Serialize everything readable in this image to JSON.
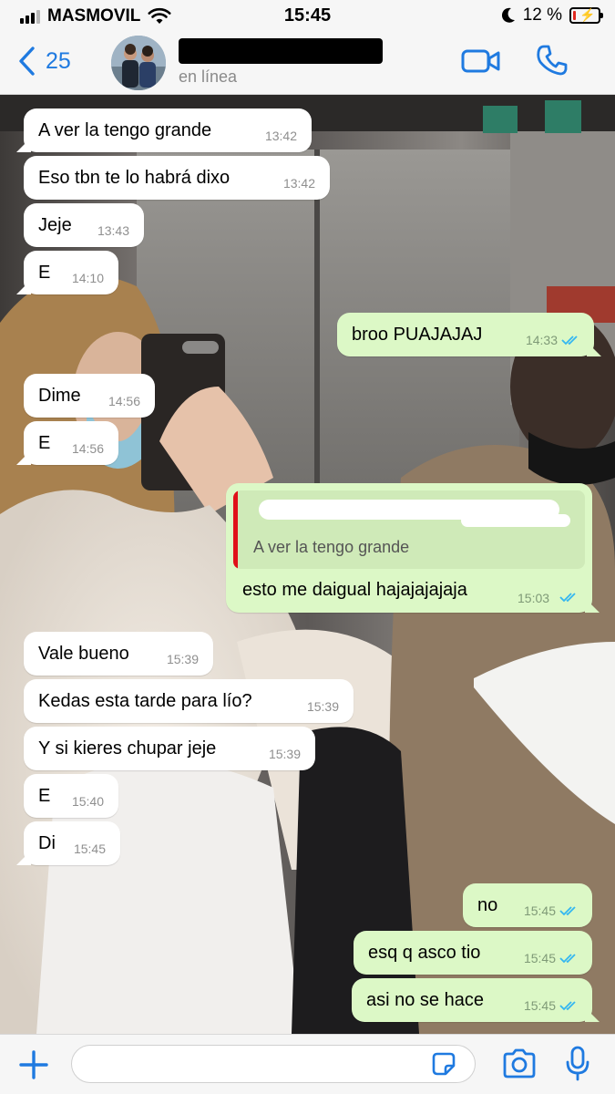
{
  "status_bar": {
    "carrier": "MASMOVIL",
    "time": "15:45",
    "battery_percent": "12 %",
    "battery_level": 0.12
  },
  "header": {
    "back_count": "25",
    "contact_status": "en línea",
    "icons": [
      "back-chevron-icon",
      "video-call-icon",
      "phone-icon"
    ]
  },
  "messages": [
    {
      "dir": "in",
      "text": "A ver la tengo grande",
      "time": "13:42"
    },
    {
      "dir": "in",
      "text": "Eso tbn te lo habrá dixo",
      "time": "13:42"
    },
    {
      "dir": "in",
      "text": "Jeje",
      "time": "13:43"
    },
    {
      "dir": "in",
      "text": "E",
      "time": "14:10"
    },
    {
      "dir": "out",
      "text": "broo PUAJAJAJ",
      "time": "14:33"
    },
    {
      "dir": "in",
      "text": "Dime",
      "time": "14:56"
    },
    {
      "dir": "in",
      "text": "E",
      "time": "14:56"
    },
    {
      "dir": "out",
      "text": "esto me daigual hajajajajaja",
      "time": "15:03",
      "quoted_text": "A ver la tengo grande"
    },
    {
      "dir": "in",
      "text": "Vale bueno",
      "time": "15:39"
    },
    {
      "dir": "in",
      "text": "Kedas esta tarde para lío?",
      "time": "15:39"
    },
    {
      "dir": "in",
      "text": "Y si kieres chupar jeje",
      "time": "15:39"
    },
    {
      "dir": "in",
      "text": "E",
      "time": "15:40"
    },
    {
      "dir": "in",
      "text": "Di",
      "time": "15:45"
    },
    {
      "dir": "out",
      "text": "no",
      "time": "15:45"
    },
    {
      "dir": "out",
      "text": "esq q asco tio",
      "time": "15:45"
    },
    {
      "dir": "out",
      "text": "asi no se hace",
      "time": "15:45"
    }
  ],
  "input_bar": {
    "placeholder": "",
    "icons": [
      "plus-icon",
      "sticker-icon",
      "camera-icon",
      "microphone-icon"
    ]
  },
  "colors": {
    "accent": "#1f7ae0",
    "incoming_bubble": "#ffffff",
    "outgoing_bubble": "#dcf8c6",
    "read_ticks": "#34b7f1",
    "quote_bar": "#e0101a"
  }
}
